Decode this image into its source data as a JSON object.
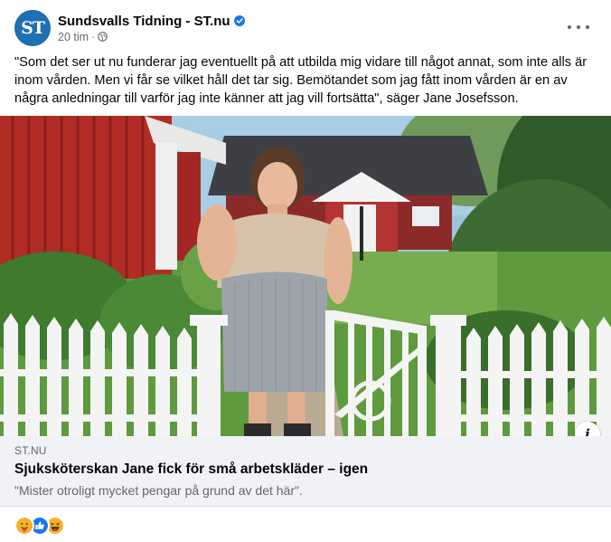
{
  "page": {
    "name": "Sundsvalls Tidning - ST.nu",
    "logo_text": "ST",
    "time": "20 tim",
    "dot": "·",
    "more_label": "•••"
  },
  "post": {
    "text": "\"Som det ser ut nu funderar jag eventuellt på att utbilda mig vidare till något annat, som inte alls är inom vården. Men vi får se vilket håll det tar sig. Bemötandet som jag fått inom vården är en av några anledningar till varför jag inte känner att jag vill fortsätta\", säger Jane Josefsson."
  },
  "link": {
    "domain": "ST.NU",
    "title": "Sjuksköterskan Jane fick för små arbetskläder – igen",
    "subtitle": "\"Mister otroligt mycket pengar på grund av det här\"."
  },
  "info_label": "i",
  "reactions": [
    "care",
    "like",
    "haha"
  ],
  "colors": {
    "brand": "#1f6fb3",
    "verified": "#1877f2",
    "like": "#1877f2",
    "care": "#f7b125",
    "haha": "#f7b125"
  }
}
